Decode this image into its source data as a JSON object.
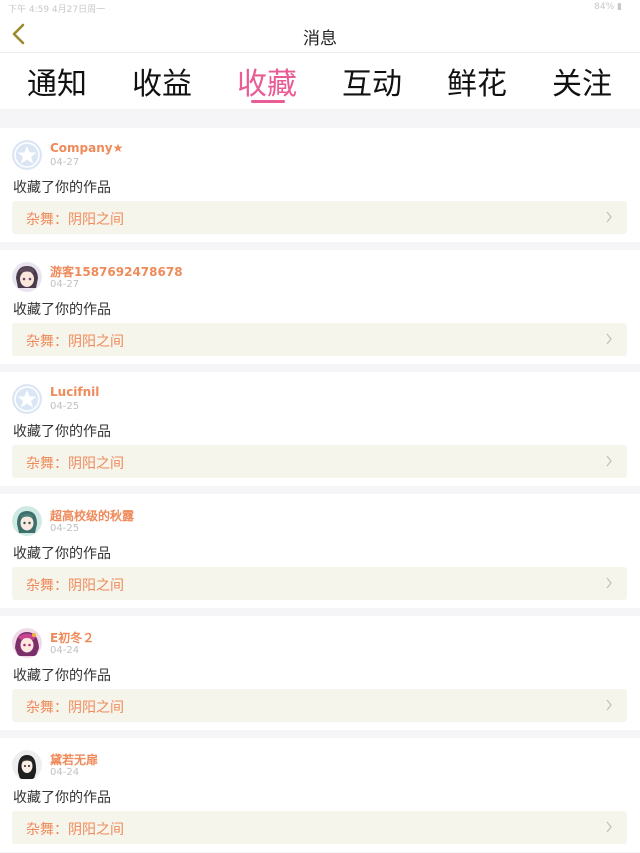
{
  "status": {
    "left_text": "下午 4:59  4月27日周一",
    "right_text": "84% ▮"
  },
  "nav": {
    "title": "消息"
  },
  "tabs": [
    {
      "label": "通知"
    },
    {
      "label": "收益"
    },
    {
      "label": "收藏",
      "active": true
    },
    {
      "label": "互动"
    },
    {
      "label": "鲜花"
    },
    {
      "label": "关注"
    }
  ],
  "colors": {
    "accent": "#ea5c95",
    "username": "#ef8a5a",
    "work_bg": "#f6f5ec"
  },
  "items": [
    {
      "user": "Company★",
      "date": "04-27",
      "action": "收藏了你的作品",
      "work": "杂舞：阴阳之间",
      "avatar": "default-star-icon"
    },
    {
      "user": "游客1587692478678",
      "date": "04-27",
      "action": "收藏了你的作品",
      "work": "杂舞：阴阳之间",
      "avatar": "anime-girl-avatar"
    },
    {
      "user": "Lucifnil",
      "date": "04-25",
      "action": "收藏了你的作品",
      "work": "杂舞：阴阳之间",
      "avatar": "default-star-icon"
    },
    {
      "user": "超高校级的秋露",
      "date": "04-25",
      "action": "收藏了你的作品",
      "work": "杂舞：阴阳之间",
      "avatar": "teal-hair-avatar"
    },
    {
      "user": "E初冬２",
      "date": "04-24",
      "action": "收藏了你的作品",
      "work": "杂舞：阴阳之间",
      "avatar": "purple-anime-avatar"
    },
    {
      "user": "黛若无扉",
      "date": "04-24",
      "action": "收藏了你的作品",
      "work": "杂舞：阴阳之间",
      "avatar": "dark-hair-avatar"
    }
  ]
}
